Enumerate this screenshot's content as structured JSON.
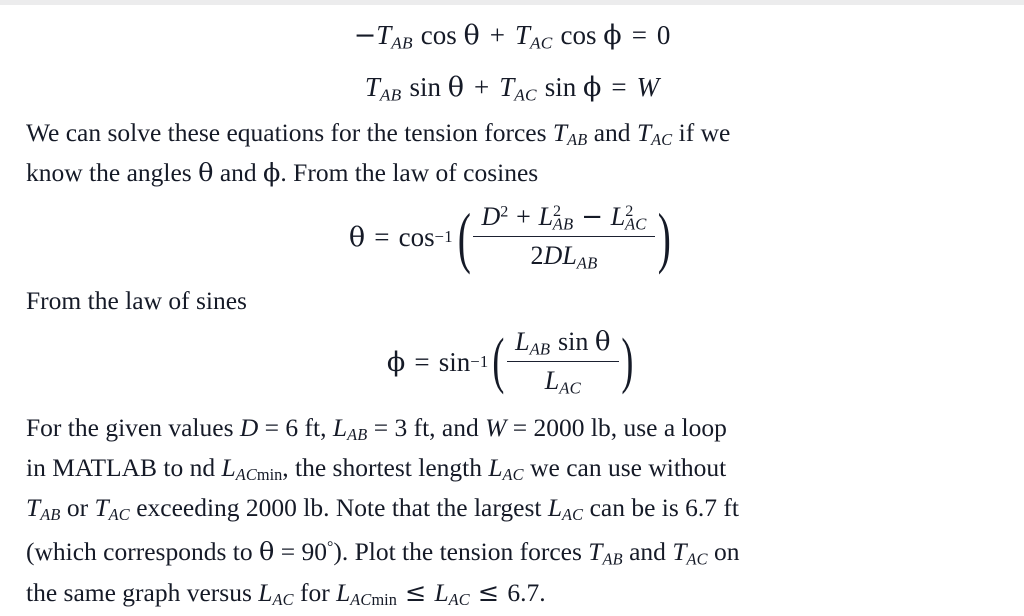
{
  "document": {
    "type": "textbook-problem-page",
    "background_color": "#ffffff",
    "text_color": "#151a27"
  },
  "equations": {
    "eq1": {
      "name": "horizontal-force-balance",
      "minus": "−",
      "T_ab": "T",
      "sub_ab": "AB",
      "cos1": "cos",
      "theta": "θ",
      "plus": "+",
      "T_ac": "T",
      "sub_ac": "AC",
      "cos2": "cos",
      "phi": "ϕ",
      "equals": "=",
      "rhs": "0"
    },
    "eq2": {
      "name": "vertical-force-balance",
      "T_ab": "T",
      "sub_ab": "AB",
      "sin1": "sin",
      "theta": "θ",
      "plus": "+",
      "T_ac": "T",
      "sub_ac": "AC",
      "sin2": "sin",
      "phi": "ϕ",
      "equals": "=",
      "rhs": "W"
    },
    "eq3": {
      "name": "law-of-cosines-theta",
      "lhs": "θ",
      "equals": "=",
      "func": "cos",
      "exponent": "−1",
      "open_paren": "(",
      "close_paren": ")",
      "numerator": {
        "D": "D",
        "D_sup": "2",
        "plus": "+",
        "L1": "L",
        "L1_sub": "AB",
        "L1_sup": "2",
        "minus": "−",
        "L2": "L",
        "L2_sub": "AC",
        "L2_sup": "2"
      },
      "denominator": {
        "two": "2",
        "D": "D",
        "L": "L",
        "L_sub": "AB"
      }
    },
    "eq4": {
      "name": "law-of-sines-phi",
      "lhs": "ϕ",
      "equals": "=",
      "func": "sin",
      "exponent": "−1",
      "open_paren": "(",
      "close_paren": ")",
      "numerator": {
        "L": "L",
        "L_sub": "AB",
        "sin": "sin",
        "theta": "θ"
      },
      "denominator": {
        "L": "L",
        "L_sub": "AC"
      }
    }
  },
  "paragraph1": {
    "name": "solve-for-tension-paragraph",
    "line1_a": "We can solve these equations for the tension forces ",
    "line1_T1": "T",
    "line1_T1_sub": "AB",
    "line1_b": " and ",
    "line1_T2": "T",
    "line1_T2_sub": "AC",
    "line1_c": " if we",
    "line2_a": "know the angles ",
    "line2_theta": "θ",
    "line2_b": " and ",
    "line2_phi": "ϕ",
    "line2_c": ". From the law of cosines"
  },
  "paragraph2": {
    "name": "law-of-sines-intro",
    "text": "From the law of sines"
  },
  "paragraph3": {
    "name": "problem-statement-paragraph",
    "line1": {
      "a": "For the given values ",
      "D": "D",
      "b": " = 6 ft, ",
      "L": "L",
      "L_sub": "AB",
      "c": " = 3 ft, and ",
      "W": "W",
      "d": " = 2000 lb, use a loop"
    },
    "line2": {
      "a": "in MATLAB to  nd  ",
      "L1": "L",
      "L1_sub_it": "AC",
      "L1_sub_rm": "min",
      "b": ", the shortest length ",
      "L2": "L",
      "L2_sub": "AC",
      "c": " we can use without"
    },
    "line3": {
      "T1": "T",
      "T1_sub": "AB",
      "a": " or ",
      "T2": "T",
      "T2_sub": "AC",
      "b": " exceeding 2000 lb. Note that the largest ",
      "L": "L",
      "L_sub": "AC",
      "c": " can be is 6.7 ft"
    },
    "line4": {
      "a": "(which corresponds to ",
      "theta": "θ",
      "b": " = 90",
      "deg": "°",
      "c": "). Plot the tension forces ",
      "T1": "T",
      "T1_sub": "AB",
      "d": " and ",
      "T2": "T",
      "T2_sub": "AC",
      "e": " on"
    },
    "line5": {
      "a": "the same graph versus ",
      "L1": "L",
      "L1_sub": "AC",
      "b": " for ",
      "L2": "L",
      "L2_sub_it": "AC",
      "L2_sub_rm": "min",
      "le1": " ≤ ",
      "L3": "L",
      "L3_sub": "AC",
      "le2": " ≤ ",
      "c": "6.7."
    }
  }
}
